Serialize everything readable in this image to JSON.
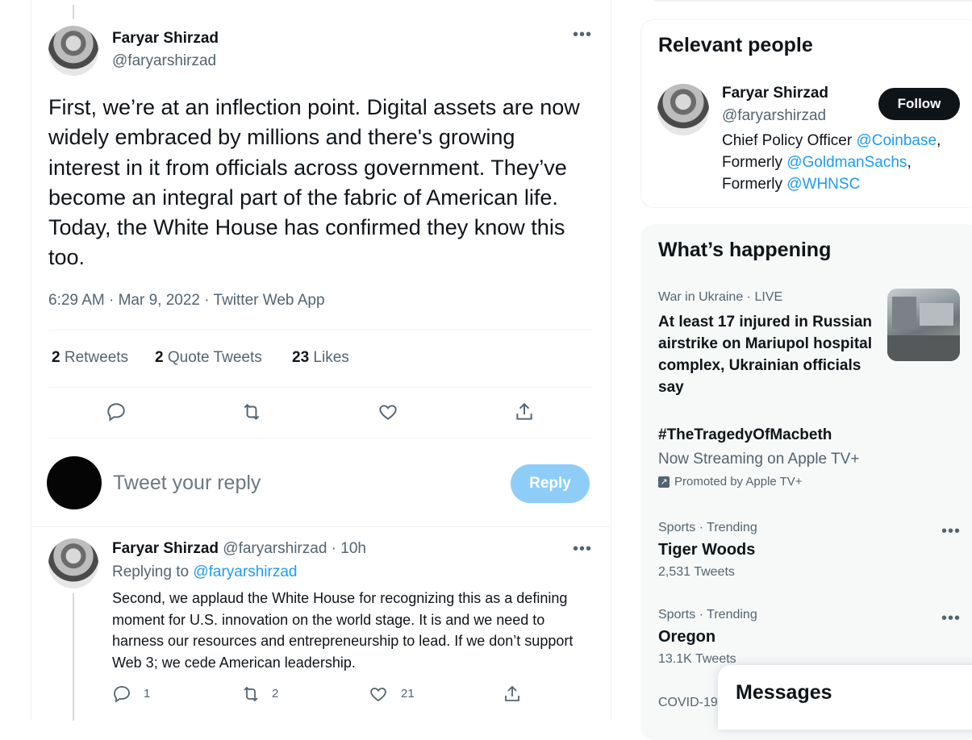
{
  "tweet": {
    "author_name": "Faryar Shirzad",
    "author_handle": "@faryarshirzad",
    "text": "First, we’re at an inflection point. Digital assets are now widely embraced by millions and there's growing interest in it from officials across government. They’ve become an integral part of the fabric of American life. Today, the White House has confirmed they know this too.",
    "meta": "6:29 AM · Mar 9, 2022 · Twitter Web App",
    "retweets_count": "2",
    "retweets_label": "Retweets",
    "quotes_count": "2",
    "quotes_label": "Quote Tweets",
    "likes_count": "23",
    "likes_label": "Likes",
    "icons": [
      "reply-icon",
      "retweet-icon",
      "like-icon",
      "share-icon"
    ]
  },
  "compose": {
    "placeholder": "Tweet your reply",
    "reply_label": "Reply"
  },
  "reply": {
    "author_name": "Faryar Shirzad",
    "author_handle": "@faryarshirzad",
    "time": "· 10h",
    "replying_to_label": "Replying to",
    "replying_to_handle": "@faryarshirzad",
    "text": "Second, we applaud the White House for recognizing this as a defining moment for U.S. innovation on the world stage. It is and we need to harness our resources and entrepreneurship to lead. If we don’t support Web 3; we cede American leadership.",
    "replies": "1",
    "retweets": "2",
    "likes": "21"
  },
  "relevant_people": {
    "title": "Relevant people",
    "name": "Faryar Shirzad",
    "handle": "@faryarshirzad",
    "follow_label": "Follow",
    "bio_line1_prefix": "Chief Policy Officer ",
    "bio_line1_link": "@Coinbase",
    "bio_line1_suffix": ",",
    "bio_line2_prefix": "Formerly ",
    "bio_line2_link": "@GoldmanSachs",
    "bio_line2_suffix": ",",
    "bio_line3_prefix": "Formerly ",
    "bio_line3_link": "@WHNSC"
  },
  "happening": {
    "title": "What’s happening",
    "items": [
      {
        "category": "War in Ukraine",
        "live": "· LIVE",
        "title": "At least 17 injured in Russian airstrike on Mariupol hospital complex, Ukrainian officials say"
      },
      {
        "title": "#TheTragedyOfMacbeth",
        "subtitle": "Now Streaming on Apple TV+",
        "promoted": "Promoted by Apple TV+"
      },
      {
        "category": "Sports · Trending",
        "title": "Tiger Woods",
        "count": "2,531 Tweets"
      },
      {
        "category": "Sports · Trending",
        "title": "Oregon",
        "count": "13.1K Tweets"
      },
      {
        "category": "COVID-19"
      }
    ]
  },
  "messages": {
    "title": "Messages"
  }
}
